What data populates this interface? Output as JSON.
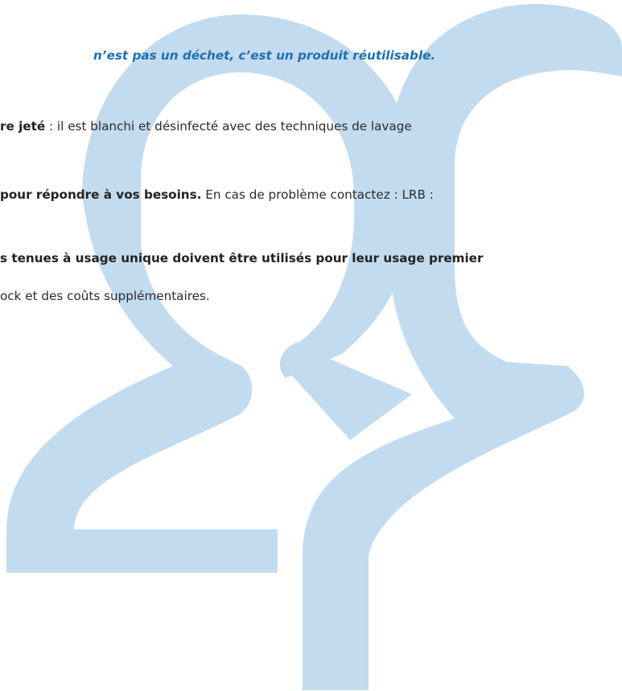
{
  "document": {
    "tagline": "n’est pas un déchet, c’est un produit réutilisable.",
    "line1": {
      "bold": "re jeté",
      "rest": " : il est blanchi et désinfecté avec des techniques de lavage"
    },
    "line2": {
      "bold": "pour répondre à vos besoins.",
      "rest": " En cas de problème contactez : LRB :"
    },
    "line3": {
      "bold": "s tenues à usage unique doivent être utilisés pour leur usage premier"
    },
    "line4": {
      "text": "ock et des coûts supplémentaires."
    }
  },
  "colors": {
    "watermark": "#c3dbef",
    "tagline": "#1f6fb2",
    "text": "#2b2b2b"
  },
  "watermark": {
    "icon": "users-icon"
  }
}
